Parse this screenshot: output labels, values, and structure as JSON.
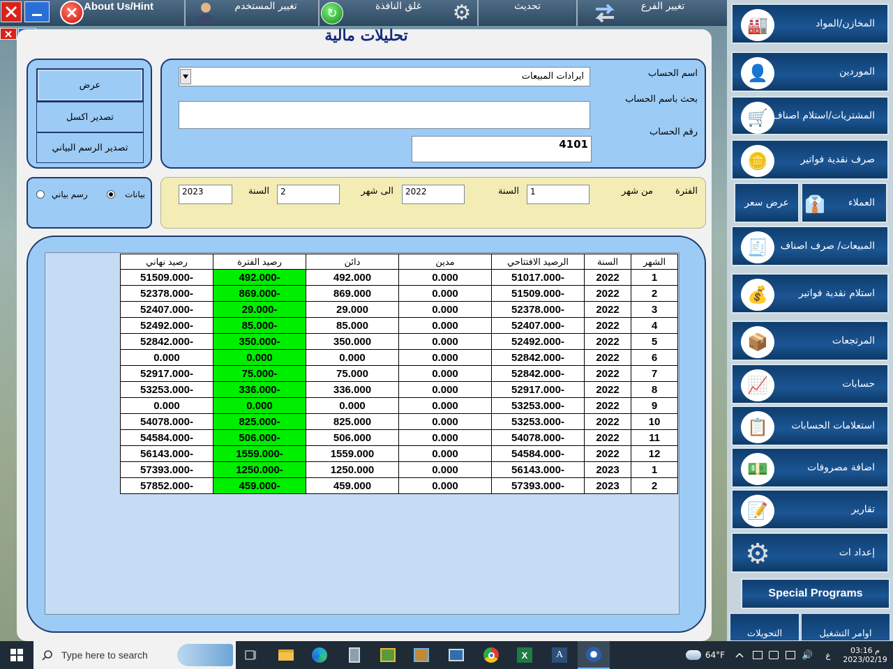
{
  "toolbar": {
    "about_label": "About Us/Hint",
    "change_user_label": "تغيير المستخدم",
    "close_window_label": "غلق النافذة",
    "refresh_label": "تحديث",
    "change_branch_label": "تغيير الفرع"
  },
  "page": {
    "title": "تحليلات مالية"
  },
  "account": {
    "name_label": "اسم الحساب",
    "name_value": "ايرادات المبيعات",
    "search_label": "بحث باسم الحساب",
    "search_value": "",
    "number_label": "رقم الحساب",
    "number_value": "4101"
  },
  "actions": {
    "view_label": "عرض",
    "export_excel_label": "تصدير اكسل",
    "export_chart_label": "تصدير الرسم البياني"
  },
  "period": {
    "period_label": "الفترة",
    "from_month_label": "من شهر",
    "from_month_value": "1",
    "year_label": "السنة",
    "from_year_value": "2022",
    "to_month_label": "الى شهر",
    "to_month_value": "2",
    "year2_label": "السنة",
    "to_year_value": "2023"
  },
  "mode": {
    "data_label": "بيانات",
    "chart_label": "رسم بياني",
    "selected": "data"
  },
  "table": {
    "columns": [
      "الشهر",
      "السنة",
      "الرصيد الافتتاحي",
      "مدين",
      "دائن",
      "رصيد الفترة",
      "رصيد نهاني"
    ],
    "rows": [
      [
        "1",
        "2022",
        "51017.000-",
        "0.000",
        "492.000",
        "492.000-",
        "51509.000-"
      ],
      [
        "2",
        "2022",
        "51509.000-",
        "0.000",
        "869.000",
        "869.000-",
        "52378.000-"
      ],
      [
        "3",
        "2022",
        "52378.000-",
        "0.000",
        "29.000",
        "29.000-",
        "52407.000-"
      ],
      [
        "4",
        "2022",
        "52407.000-",
        "0.000",
        "85.000",
        "85.000-",
        "52492.000-"
      ],
      [
        "5",
        "2022",
        "52492.000-",
        "0.000",
        "350.000",
        "350.000-",
        "52842.000-"
      ],
      [
        "6",
        "2022",
        "52842.000-",
        "0.000",
        "0.000",
        "0.000",
        "0.000"
      ],
      [
        "7",
        "2022",
        "52842.000-",
        "0.000",
        "75.000",
        "75.000-",
        "52917.000-"
      ],
      [
        "8",
        "2022",
        "52917.000-",
        "0.000",
        "336.000",
        "336.000-",
        "53253.000-"
      ],
      [
        "9",
        "2022",
        "53253.000-",
        "0.000",
        "0.000",
        "0.000",
        "0.000"
      ],
      [
        "10",
        "2022",
        "53253.000-",
        "0.000",
        "825.000",
        "825.000-",
        "54078.000-"
      ],
      [
        "11",
        "2022",
        "54078.000-",
        "0.000",
        "506.000",
        "506.000-",
        "54584.000-"
      ],
      [
        "12",
        "2022",
        "54584.000-",
        "0.000",
        "1559.000",
        "1559.000-",
        "56143.000-"
      ],
      [
        "1",
        "2023",
        "56143.000-",
        "0.000",
        "1250.000",
        "1250.000-",
        "57393.000-"
      ],
      [
        "2",
        "2023",
        "57393.000-",
        "0.000",
        "459.000",
        "459.000-",
        "57852.000-"
      ]
    ]
  },
  "sidebar": {
    "items": [
      {
        "label": "المخازن/المواد",
        "icon": "warehouse-icon"
      },
      {
        "label": "الموردين",
        "icon": "supplier-icon"
      },
      {
        "label": "المشتريات/استلام اصناف",
        "icon": "cart-icon"
      },
      {
        "label": "صرف نقدية فواتير",
        "icon": "coins-icon"
      },
      {
        "label": "العملاء",
        "icon": "customer-icon"
      },
      {
        "label": "المبيعات/ صرف اصناف",
        "icon": "register-icon"
      },
      {
        "label": "استلام نقدية فواتير",
        "icon": "money-bag-icon"
      },
      {
        "label": "المرتجعات",
        "icon": "returns-icon"
      },
      {
        "label": "حسابات",
        "icon": "accounts-icon"
      },
      {
        "label": "استعلامات الحسابات",
        "icon": "inquiry-icon"
      },
      {
        "label": "اضافة مصروفات",
        "icon": "expenses-icon"
      },
      {
        "label": "تقارير",
        "icon": "reports-icon"
      },
      {
        "label": "إعداد ات",
        "icon": "gear-icon"
      }
    ],
    "price_quote_label": "عرض سعر",
    "special_programs_label": "Special Programs",
    "conversions_label": "التحويلات",
    "run_commands_label": "اوامر التشغيل"
  },
  "taskbar": {
    "search_placeholder": "Type here to search",
    "weather": "64°F",
    "lang": "ع",
    "time": "م 03:16",
    "date": "2023/02/19"
  },
  "colors": {
    "panel_blue": "#9ccbf5",
    "period_yellow": "#f3ecb5",
    "highlight_green": "#00ee00",
    "title_navy": "#132a7a"
  }
}
